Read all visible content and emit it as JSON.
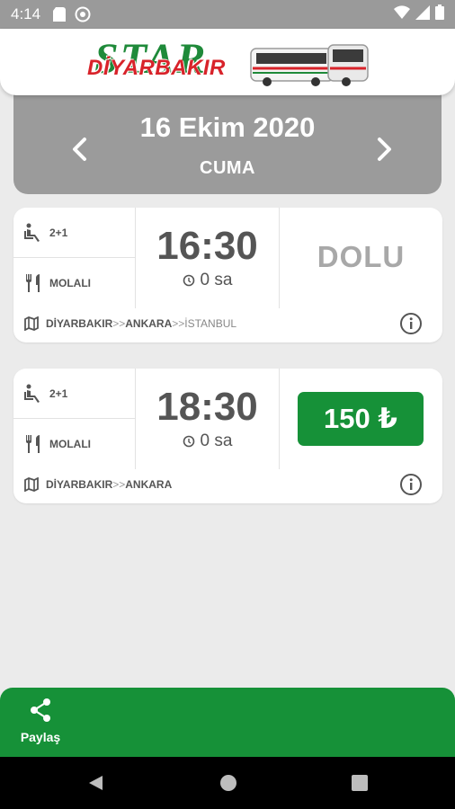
{
  "status_bar": {
    "time": "4:14",
    "icons": [
      "sd-card-icon",
      "no-disturb-icon",
      "wifi-icon",
      "signal-icon",
      "battery-icon"
    ]
  },
  "header": {
    "logo_star": "STAR",
    "logo_name": "DİYARBAKIR"
  },
  "date_panel": {
    "date": "16 Ekim 2020",
    "day": "CUMA",
    "prev_icon": "chevron-left-icon",
    "next_icon": "chevron-right-icon"
  },
  "trips": [
    {
      "seating": "2+1",
      "meal": "MOLALI",
      "time": "16:30",
      "duration": "0 sa",
      "status": "DOLU",
      "route": {
        "from": "DİYARBAKIR",
        "sep1": ">>",
        "via": "ANKARA",
        "sep2": ">>",
        "to": "İSTANBUL"
      }
    },
    {
      "seating": "2+1",
      "meal": "MOLALI",
      "time": "18:30",
      "duration": "0 sa",
      "price": "150 ₺",
      "route": {
        "from": "DİYARBAKIR",
        "sep1": ">>",
        "via": "ANKARA"
      }
    }
  ],
  "share": {
    "label": "Paylaş"
  },
  "colors": {
    "accent_green": "#169138",
    "panel_gray": "#9b9b9b",
    "background": "#ebebeb",
    "logo_red": "#d8232a"
  }
}
